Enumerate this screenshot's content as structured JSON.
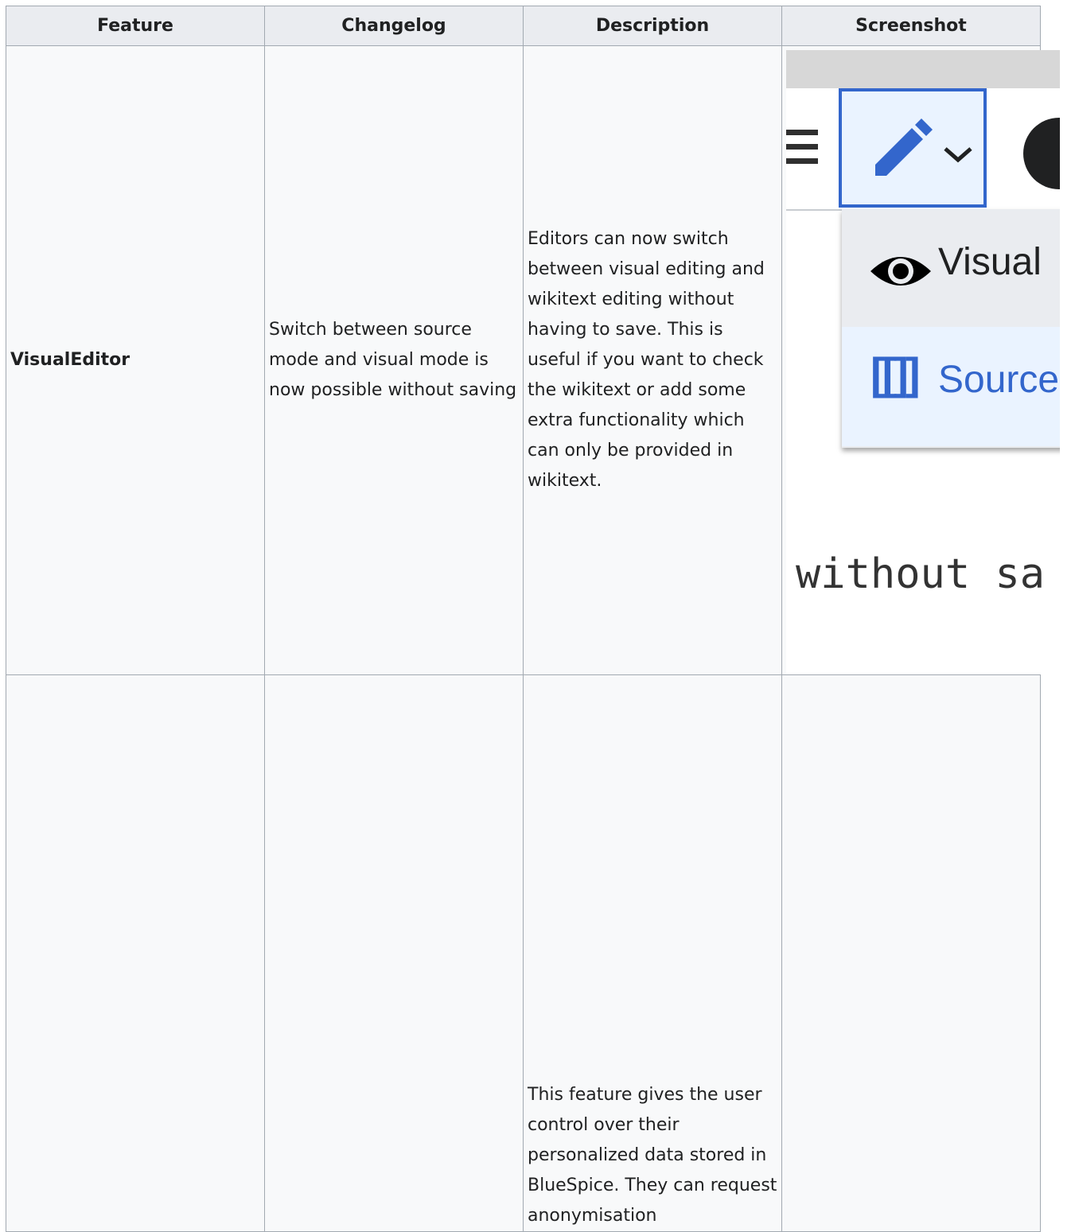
{
  "table": {
    "headers": [
      "Feature",
      "Changelog",
      "Description",
      "Screenshot"
    ],
    "rows": [
      {
        "feature": "VisualEditor",
        "changelog": "Switch between source mode and visual mode is now possible without saving",
        "description": "Editors can now switch between visual editing and wikitext editing without having to save. This is useful if you want to check the wikitext or add some extra functionality which can only be provided in wikitext.",
        "screenshot": {
          "menu_visual": "Visual",
          "menu_source": "Source",
          "brackets": "[[]]",
          "caption_text": "without sa",
          "icons": [
            "hamburger-icon",
            "pencil-icon",
            "chevron-down-icon",
            "close-icon",
            "eye-icon"
          ]
        }
      },
      {
        "feature": "",
        "changelog": "",
        "description": "This feature gives the user control over their personalized data stored in BlueSpice. They can request anonymisation",
        "screenshot": null
      }
    ]
  },
  "colors": {
    "accent": "#3366cc",
    "border": "#a2a9b1",
    "header_bg": "#eaecf0",
    "cell_bg": "#f8f9fa"
  }
}
